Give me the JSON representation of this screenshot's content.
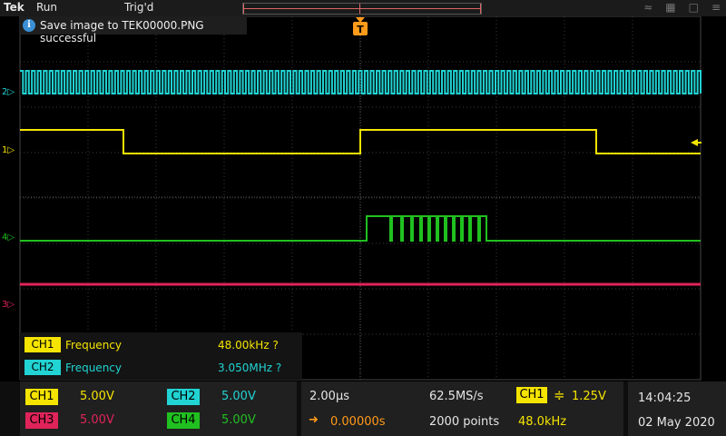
{
  "topbar": {
    "brand": "Tek",
    "run_state": "Run",
    "trigger_state": "Trig'd"
  },
  "notification": {
    "message": "Save image to TEK00000.PNG successful"
  },
  "trigger_marker": {
    "label": "T"
  },
  "channel_markers": [
    {
      "channel": "2",
      "color": "#22d3d3"
    },
    {
      "channel": "1",
      "color": "#f5e400"
    },
    {
      "channel": "4",
      "color": "#20c020"
    },
    {
      "channel": "3",
      "color": "#e0245a"
    }
  ],
  "measurements": [
    {
      "source": "CH1",
      "name": "Frequency",
      "value": "48.00kHz  ?",
      "color": "#f5e400"
    },
    {
      "source": "CH2",
      "name": "Frequency",
      "value": "3.050MHz  ?",
      "color": "#22d3d3"
    }
  ],
  "channels": [
    {
      "label": "CH1",
      "scale": "5.00V",
      "color": "#f5e400"
    },
    {
      "label": "CH2",
      "scale": "5.00V",
      "color": "#22d3d3"
    },
    {
      "label": "CH3",
      "scale": "5.00V",
      "color": "#e0245a"
    },
    {
      "label": "CH4",
      "scale": "5.00V",
      "color": "#20c020"
    }
  ],
  "horizontal": {
    "time_per_div": "2.00µs",
    "delay": "0.00000s",
    "sample_rate": "62.5MS/s",
    "record_length": "2000 points"
  },
  "trigger": {
    "source": "CH1",
    "level": "1.25V",
    "frequency": "48.0kHz"
  },
  "clock": {
    "time": "14:04:25",
    "date": "02 May 2020"
  },
  "colors": {
    "ch1": "#f5e400",
    "ch2": "#22d3d3",
    "ch3": "#e0245a",
    "ch4": "#20c020",
    "trigger": "#ff9a1a"
  }
}
